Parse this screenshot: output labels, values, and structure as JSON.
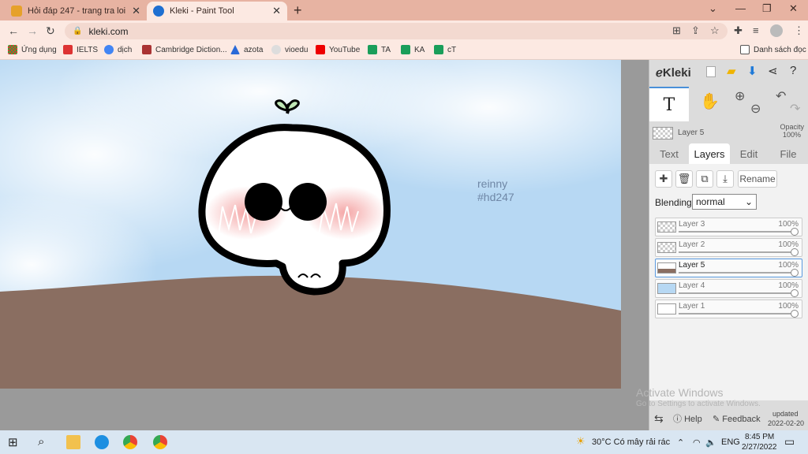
{
  "browser": {
    "tabs": [
      {
        "title": "Hỏi đáp 247 - trang tra loi",
        "active": false
      },
      {
        "title": "Kleki - Paint Tool",
        "active": true
      }
    ],
    "url": "kleki.com",
    "bookmarks": [
      "Ứng dụng",
      "IELTS",
      "dịch",
      "Cambridge Diction...",
      "azota",
      "vioedu",
      "YouTube",
      "TA",
      "KA",
      "cT"
    ],
    "reading_list": "Danh sách đọc"
  },
  "canvas": {
    "signature_line1": "reinny",
    "signature_line2": "#hd247",
    "ground_color": "#8a6e61",
    "sky_color": "#b7d8f3"
  },
  "panel": {
    "logo": "Kleki",
    "current_layer": "Layer 5",
    "opacity_label": "Opacity",
    "opacity_value": "100%",
    "tabs": [
      "Text",
      "Layers",
      "Edit",
      "File"
    ],
    "active_tab": "Layers",
    "rename_label": "Rename",
    "blending_label": "Blending",
    "blending_value": "normal",
    "layers": [
      {
        "name": "Layer 3",
        "opacity": "100%",
        "active": false
      },
      {
        "name": "Layer 2",
        "opacity": "100%",
        "active": false
      },
      {
        "name": "Layer 5",
        "opacity": "100%",
        "active": true
      },
      {
        "name": "Layer 4",
        "opacity": "100%",
        "active": false
      },
      {
        "name": "Layer 1",
        "opacity": "100%",
        "active": false
      }
    ],
    "footer": {
      "help": "Help",
      "feedback": "Feedback",
      "updated_label": "updated",
      "updated_date": "2022-02-20"
    }
  },
  "windows": {
    "activate_title": "Activate Windows",
    "activate_sub": "Go to Settings to activate Windows.",
    "weather": "30°C  Có mây rải rác",
    "language": "ENG",
    "time": "8:45 PM",
    "date": "2/27/2022"
  }
}
